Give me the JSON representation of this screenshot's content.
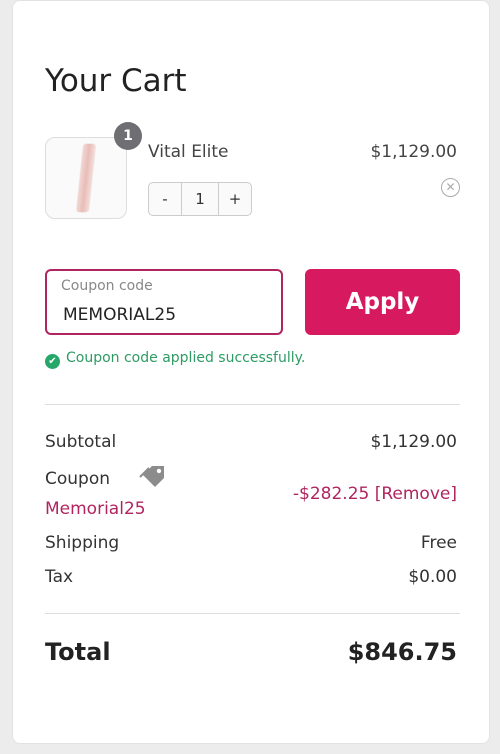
{
  "cart": {
    "title": "Your Cart",
    "item": {
      "name": "Vital Elite",
      "price": "$1,129.00",
      "count_badge": "1",
      "quantity": "1",
      "dec_label": "-",
      "inc_label": "+",
      "remove_icon": "close-circle-icon"
    }
  },
  "coupon": {
    "placeholder": "Coupon code",
    "value": "MEMORIAL25",
    "apply_label": "Apply",
    "success_message": "Coupon code applied successfully.",
    "accent_color": "#d71a5f",
    "success_color": "#2d9b63"
  },
  "summary": {
    "subtotal_label": "Subtotal",
    "subtotal_value": "$1,129.00",
    "coupon_label": "Coupon",
    "coupon_code": "Memorial25",
    "coupon_discount": "-$282.25",
    "coupon_remove": "[Remove]",
    "shipping_label": "Shipping",
    "shipping_value": "Free",
    "tax_label": "Tax",
    "tax_value": "$0.00",
    "total_label": "Total",
    "total_value": "$846.75"
  }
}
